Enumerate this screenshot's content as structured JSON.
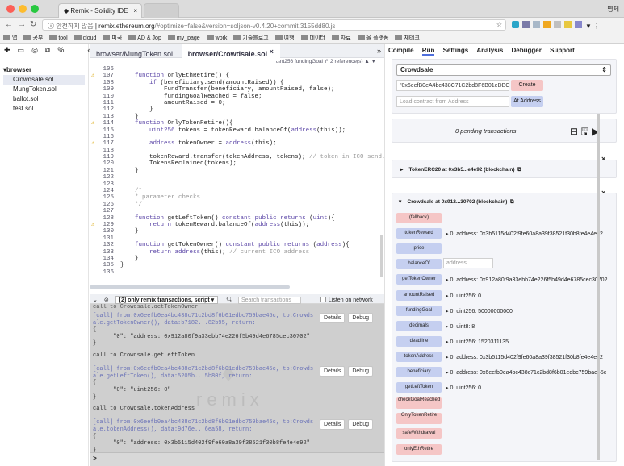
{
  "browser": {
    "tab_title": "Remix - Solidity IDE",
    "user": "명제",
    "security_label": "안전하지 않음",
    "url_host": "remix.ethereum.org",
    "url_rest": "/#optimize=false&version=soljson-v0.4.20+commit.3155dd80.js",
    "bookmarks": [
      "앱",
      "공부",
      "tool",
      "cloud",
      "미국",
      "AD & Jop",
      "my_page",
      "work",
      "기술블로그",
      "여행",
      "데이터",
      "자료",
      "올 플랫폼",
      "재테크"
    ]
  },
  "files": {
    "root": "▾browser",
    "items": [
      "Crowdsale.sol",
      "MungToken.sol",
      "ballot.sol",
      "test.sol"
    ]
  },
  "editor": {
    "tabs": [
      "browser/MungToken.sol",
      "browser/Crowdsale.sol"
    ],
    "info": "uint256 fundingGoal  ↱   2 reference(s) ▲ ▼",
    "lines": [
      {
        "n": "106",
        "c": "",
        "w": false
      },
      {
        "n": "107",
        "c": "    function onlyEthRetire() {",
        "w": true
      },
      {
        "n": "108",
        "c": "        if (beneficiary.send(amountRaised)) {",
        "w": false
      },
      {
        "n": "109",
        "c": "            FundTransfer(beneficiary, amountRaised, false);",
        "w": false
      },
      {
        "n": "110",
        "c": "            fundingGoalReached = false;",
        "w": false
      },
      {
        "n": "111",
        "c": "            amountRaised = 0;",
        "w": false
      },
      {
        "n": "112",
        "c": "        }",
        "w": false
      },
      {
        "n": "113",
        "c": "    }",
        "w": false
      },
      {
        "n": "114",
        "c": "    function OnlyTokenRetire(){",
        "w": true
      },
      {
        "n": "115",
        "c": "        uint256 tokens = tokenReward.balanceOf(address(this));",
        "w": false
      },
      {
        "n": "116",
        "c": "",
        "w": false
      },
      {
        "n": "117",
        "c": "        address tokenOwner = address(this);",
        "w": true
      },
      {
        "n": "118",
        "c": "",
        "w": false
      },
      {
        "n": "119",
        "c": "        tokenReward.transfer(tokenAddress, tokens); // token in ICO send,  from: c",
        "w": false
      },
      {
        "n": "120",
        "c": "        TokensReclaimed(tokens);",
        "w": false
      },
      {
        "n": "121",
        "c": "    }",
        "w": false
      },
      {
        "n": "122",
        "c": "",
        "w": false
      },
      {
        "n": "123",
        "c": "",
        "w": false
      },
      {
        "n": "124",
        "c": "    /*",
        "w": false
      },
      {
        "n": "125",
        "c": "    * parameter checks",
        "w": false
      },
      {
        "n": "126",
        "c": "    */",
        "w": false
      },
      {
        "n": "127",
        "c": "",
        "w": false
      },
      {
        "n": "128",
        "c": "    function getLeftToken() constant public returns (uint){",
        "w": false
      },
      {
        "n": "129",
        "c": "        return tokenReward.balanceOf(address(this));",
        "w": true
      },
      {
        "n": "130",
        "c": "    }",
        "w": false
      },
      {
        "n": "131",
        "c": "",
        "w": false
      },
      {
        "n": "132",
        "c": "    function getTokenOwner() constant public returns (address){",
        "w": false
      },
      {
        "n": "133",
        "c": "        return address(this); // current ICO address",
        "w": false
      },
      {
        "n": "134",
        "c": "    }",
        "w": false
      },
      {
        "n": "135",
        "c": "}",
        "w": false
      },
      {
        "n": "136",
        "c": "",
        "w": false
      }
    ]
  },
  "terminal": {
    "filter": "[2] only remix transactions, script ▾",
    "search_placeholder": "Search transactions",
    "listen": "Listen on network",
    "watermark": "remix",
    "prompt": ">",
    "details": "Details",
    "debug": "Debug",
    "blocks": [
      {
        "lines": [
          "[call] from:0x6eefb0ea4bc438c71c2bd8f6b01edbc759bae45c, to:Crowds",
          "ale.getTokenOwner(), data:b7182...82b95, return:",
          "{",
          "      \"0\": \"address: 0x912a80f9a33ebb74e226f5b49d4e6785cec30702\"",
          "}"
        ]
      },
      {
        "lines": [
          "call to Crowdsale.getLeftToken",
          "",
          "[call] from:0x6eefb0ea4bc438c71c2bd8f6b01edbc759bae45c, to:Crowds",
          "ale.getLeftToken(), data:5205b...5b80f, return:",
          "{",
          "      \"0\": \"uint256: 0\"",
          "}"
        ]
      },
      {
        "lines": [
          "call to Crowdsale.tokenAddress",
          "",
          "[call] from:0x6eefb0ea4bc438c71c2bd8f6b01edbc759bae45c, to:Crowds",
          "ale.tokenAddress(), data:9d76e...6ea58, return:",
          "{",
          "      \"0\": \"address: 0x3b5115d402f9fe60a8a39f38521f30b8fe4e4e92\"",
          "}"
        ]
      }
    ]
  },
  "run": {
    "tabs": [
      "Compile",
      "Run",
      "Settings",
      "Analysis",
      "Debugger",
      "Support"
    ],
    "active": "Run",
    "contract": "Crowdsale",
    "create_input": "\"0x6eefB0eA4bc438C71C2bd8F6B01eDBC7",
    "create": "Create",
    "load_placeholder": "Load contract from Address",
    "at_address": "At Address",
    "pending": "0 pending transactions",
    "instance1": "TokenERC20 at 0x3b5...e4e92 (blockchain)",
    "instance2": "Crowdsale at 0x912...30702 (blockchain)",
    "functions": [
      {
        "name": "(fallback)",
        "color": "red",
        "value": ""
      },
      {
        "name": "tokenReward",
        "color": "blue",
        "value": "▸ 0: address: 0x3b5115d402f9fe60a8a39f38521f30b8fe4e4e92"
      },
      {
        "name": "price",
        "color": "blue",
        "value": ""
      },
      {
        "name": "balanceOf",
        "color": "blue",
        "value": "",
        "input": "address"
      },
      {
        "name": "getTokenOwner",
        "color": "blue",
        "value": "▸ 0: address: 0x912a80f9a33ebb74e226f5b49d4e6785cec30702"
      },
      {
        "name": "amountRaised",
        "color": "blue",
        "value": "▸ 0: uint256: 0"
      },
      {
        "name": "fundingGoal",
        "color": "blue",
        "value": "▸ 0: uint256: 50000000000"
      },
      {
        "name": "decimals",
        "color": "blue",
        "value": "▸ 0: uint8: 8"
      },
      {
        "name": "deadline",
        "color": "blue",
        "value": "▸ 0: uint256: 1520311135"
      },
      {
        "name": "tokenAddress",
        "color": "blue",
        "value": "▸ 0: address: 0x3b5115d402f9fe60a8a39f38521f30b8fe4e4e92"
      },
      {
        "name": "beneficiary",
        "color": "blue",
        "value": "▸ 0: address: 0x6eefb0ea4bc438c71c2bd8f6b01edbc759bae45c"
      },
      {
        "name": "getLeftToken",
        "color": "blue",
        "value": "▸ 0: uint256: 0"
      },
      {
        "name": "checkGoalReached",
        "color": "red",
        "value": ""
      },
      {
        "name": "OnlyTokenRetire",
        "color": "red",
        "value": ""
      },
      {
        "name": "safeWithdrawal",
        "color": "red",
        "value": ""
      },
      {
        "name": "onlyEthRetire",
        "color": "red",
        "value": ""
      }
    ]
  }
}
